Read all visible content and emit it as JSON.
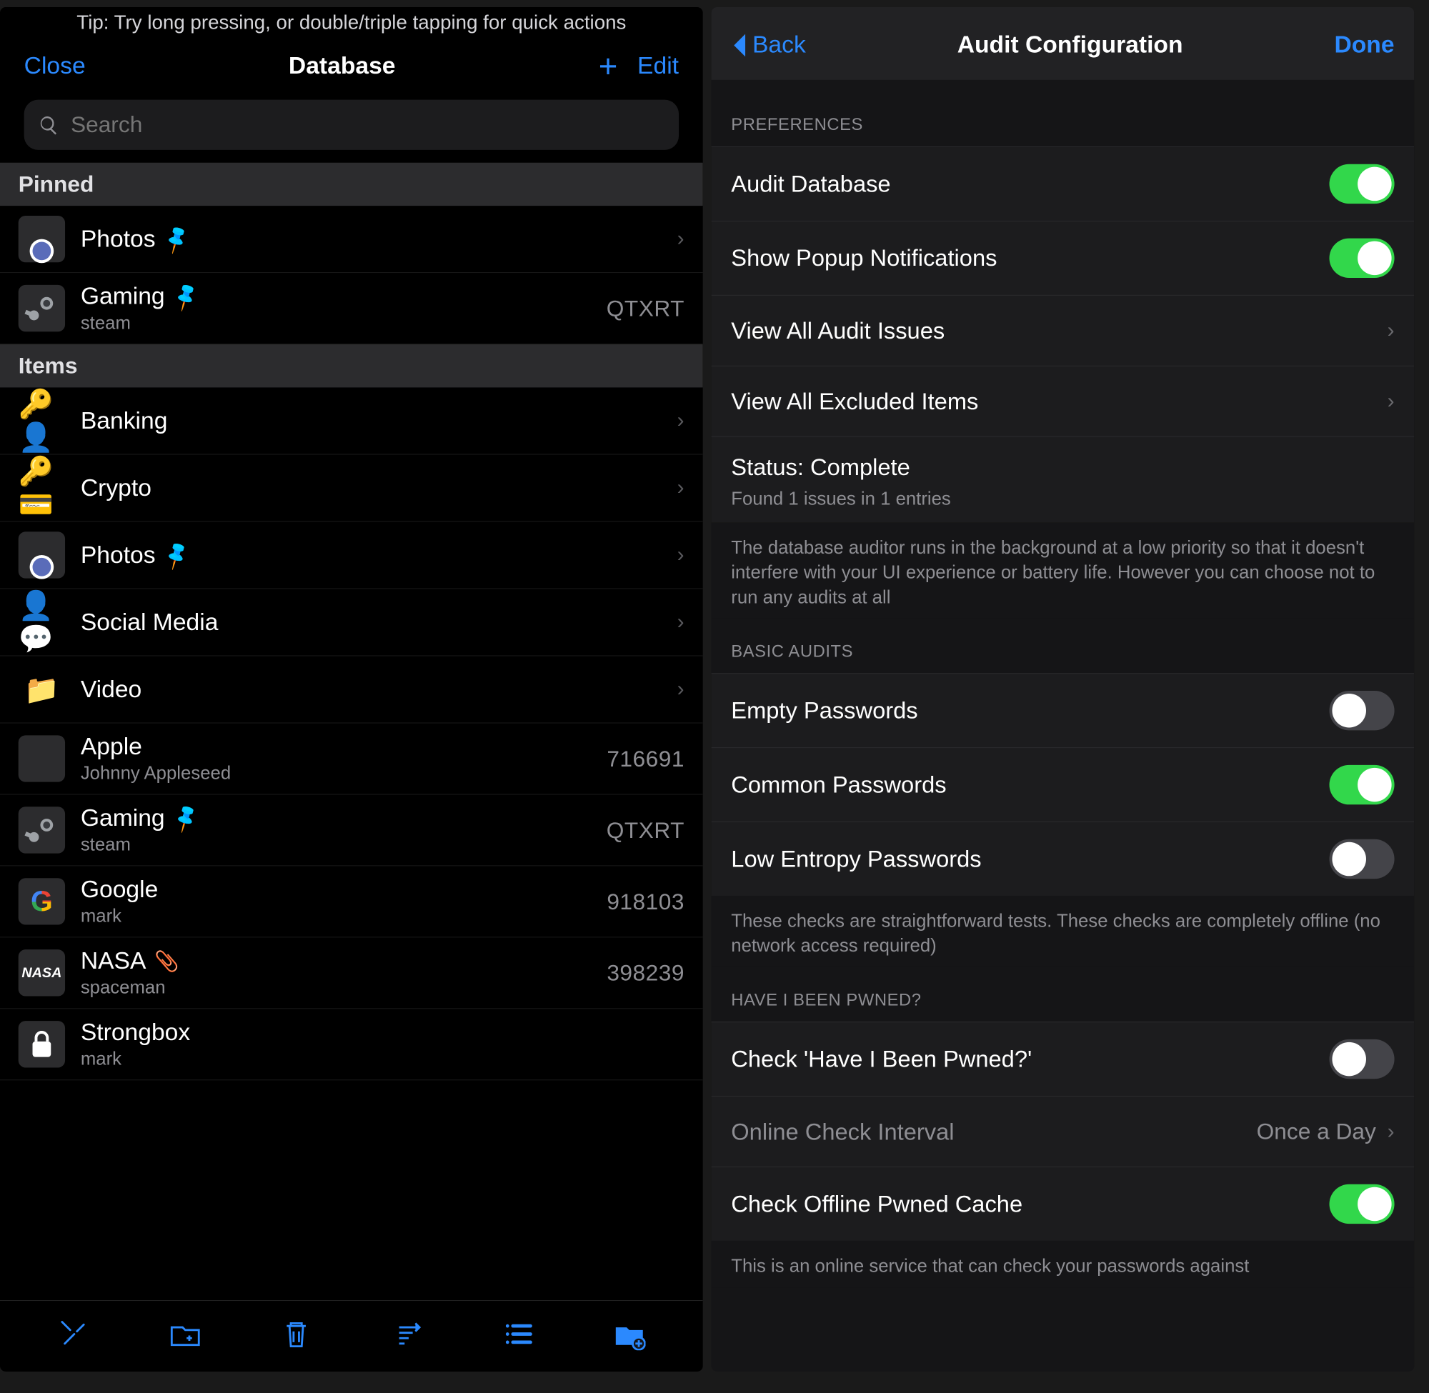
{
  "left": {
    "tip": "Tip: Try long pressing, or double/triple tapping for quick actions",
    "close": "Close",
    "title": "Database",
    "edit": "Edit",
    "search_placeholder": "Search",
    "sections": {
      "pinned": "Pinned",
      "items": "Items"
    },
    "pinned": [
      {
        "icon": "camera",
        "title": "Photos",
        "pinned": true,
        "sub": "",
        "code": "",
        "chevron": true
      },
      {
        "icon": "steam",
        "title": "Gaming",
        "pinned": true,
        "sub": "steam",
        "code": "QTXRT",
        "chevron": false
      }
    ],
    "items": [
      {
        "icon": "keyuser",
        "emoji": "🔑👤",
        "title": "Banking",
        "sub": "",
        "code": "",
        "chevron": true
      },
      {
        "icon": "keycard",
        "emoji": "🔑💳",
        "title": "Crypto",
        "sub": "",
        "code": "",
        "chevron": true
      },
      {
        "icon": "camera",
        "title": "Photos",
        "pinned": true,
        "sub": "",
        "code": "",
        "chevron": true
      },
      {
        "icon": "avatar",
        "emoji": "👤💬",
        "title": "Social Media",
        "sub": "",
        "code": "",
        "chevron": true
      },
      {
        "icon": "folder",
        "emoji": "📁",
        "title": "Video",
        "sub": "",
        "code": "",
        "chevron": true
      },
      {
        "icon": "apple",
        "title": "Apple",
        "sub": "Johnny Appleseed",
        "code": "716691",
        "chevron": false
      },
      {
        "icon": "steam",
        "title": "Gaming",
        "pinned": true,
        "sub": "steam",
        "code": "QTXRT",
        "chevron": false
      },
      {
        "icon": "google",
        "title": "Google",
        "sub": "mark",
        "code": "918103",
        "chevron": false
      },
      {
        "icon": "nasa",
        "title": "NASA",
        "attachment": true,
        "sub": "spaceman",
        "code": "398239",
        "chevron": false
      },
      {
        "icon": "lock",
        "title": "Strongbox",
        "sub": "mark",
        "code": "",
        "chevron": false
      }
    ],
    "toolbar_icons": [
      "tools",
      "folder-add",
      "trash",
      "sort",
      "list",
      "new-folder"
    ]
  },
  "right": {
    "back": "Back",
    "title": "Audit Configuration",
    "done": "Done",
    "groups": [
      {
        "header": "PREFERENCES",
        "rows": [
          {
            "type": "toggle",
            "label": "Audit Database",
            "on": true
          },
          {
            "type": "toggle",
            "label": "Show Popup Notifications",
            "on": true
          },
          {
            "type": "nav",
            "label": "View All Audit Issues"
          },
          {
            "type": "nav",
            "label": "View All Excluded Items"
          },
          {
            "type": "status",
            "label": "Status: Complete",
            "sublabel": "Found 1 issues in 1 entries"
          }
        ],
        "footer": "The database auditor runs in the background at a low priority so that it doesn't interfere with your UI experience or battery life. However you can choose not to run any audits at all"
      },
      {
        "header": "BASIC AUDITS",
        "rows": [
          {
            "type": "toggle",
            "label": "Empty Passwords",
            "on": false
          },
          {
            "type": "toggle",
            "label": "Common Passwords",
            "on": true
          },
          {
            "type": "toggle",
            "label": "Low Entropy Passwords",
            "on": false
          }
        ],
        "footer": "These checks are straightforward tests. These checks are completely offline (no network access required)"
      },
      {
        "header": "HAVE I BEEN PWNED?",
        "rows": [
          {
            "type": "toggle",
            "label": "Check 'Have I Been Pwned?'",
            "on": false
          },
          {
            "type": "value-nav",
            "label": "Online Check Interval",
            "value": "Once a Day",
            "disabled": true
          },
          {
            "type": "toggle",
            "label": "Check Offline Pwned Cache",
            "on": true
          }
        ],
        "footer": "This is an online service that can check your passwords against"
      }
    ]
  }
}
